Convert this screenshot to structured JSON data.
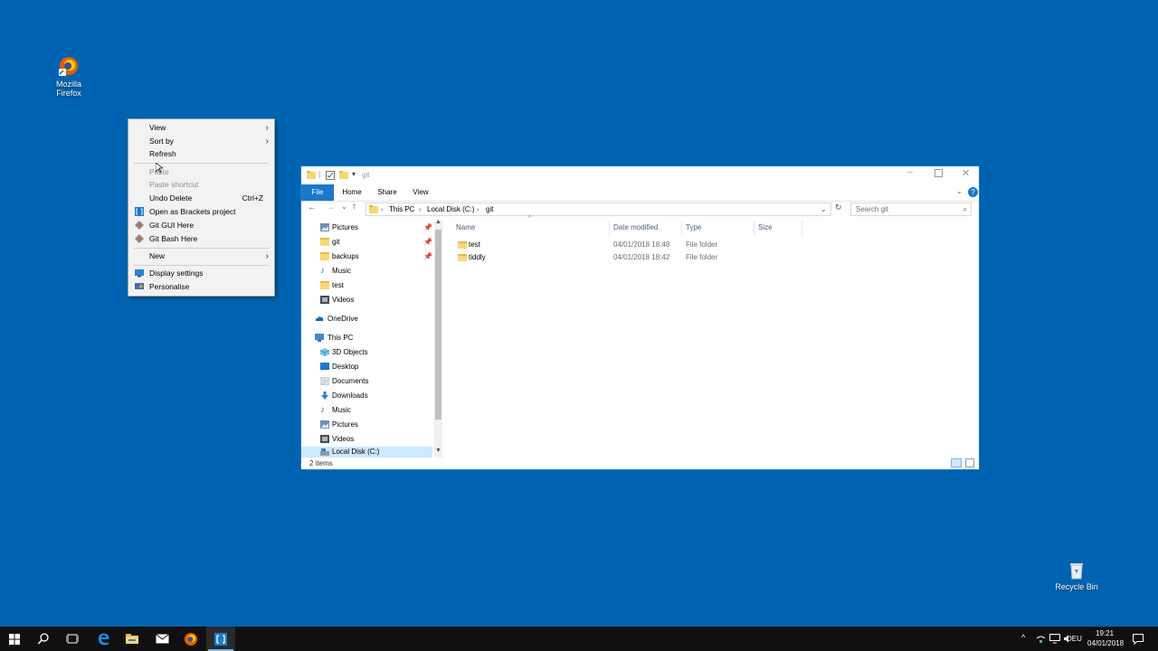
{
  "desktop": {
    "icons": [
      {
        "name": "Mozilla Firefox",
        "line1": "Mozilla",
        "line2": "Firefox",
        "icon": "firefox-icon"
      },
      {
        "name": "Recycle Bin",
        "label": "Recycle Bin",
        "icon": "recycle-bin-icon"
      }
    ]
  },
  "context_menu": {
    "items": [
      {
        "label": "View",
        "submenu": true
      },
      {
        "label": "Sort by",
        "submenu": true
      },
      {
        "label": "Refresh"
      },
      {
        "label": "Paste",
        "disabled": true
      },
      {
        "label": "Paste shortcut",
        "disabled": true
      },
      {
        "label": "Undo Delete",
        "shortcut": "Ctrl+Z"
      },
      {
        "label": "Open as Brackets project",
        "icon": "brackets-icon"
      },
      {
        "label": "Git GUI Here",
        "icon": "git-icon"
      },
      {
        "label": "Git Bash Here",
        "icon": "git-icon"
      },
      {
        "label": "New",
        "submenu": true
      },
      {
        "label": "Display settings",
        "icon": "display-icon"
      },
      {
        "label": "Personalise",
        "icon": "personalise-icon"
      }
    ]
  },
  "explorer": {
    "title": "git",
    "ribbon_tabs": [
      "File",
      "Home",
      "Share",
      "View"
    ],
    "breadcrumb": [
      "This PC",
      "Local Disk (C:)",
      "git"
    ],
    "search_placeholder": "Search git",
    "nav_items": [
      {
        "label": "Pictures",
        "icon": "pictures-icon",
        "pinned": true
      },
      {
        "label": "git",
        "icon": "folder-icon",
        "pinned": true
      },
      {
        "label": "backups",
        "icon": "folder-icon",
        "pinned": true
      },
      {
        "label": "Music",
        "icon": "music-icon"
      },
      {
        "label": "test",
        "icon": "folder-icon"
      },
      {
        "label": "Videos",
        "icon": "videos-icon"
      },
      {
        "label": "OneDrive",
        "icon": "onedrive-icon",
        "top": true
      },
      {
        "label": "This PC",
        "icon": "pc-icon",
        "top": true
      },
      {
        "label": "3D Objects",
        "icon": "3d-objects-icon"
      },
      {
        "label": "Desktop",
        "icon": "desktop-icon"
      },
      {
        "label": "Documents",
        "icon": "documents-icon"
      },
      {
        "label": "Downloads",
        "icon": "downloads-icon"
      },
      {
        "label": "Music",
        "icon": "music-icon"
      },
      {
        "label": "Pictures",
        "icon": "pictures-icon"
      },
      {
        "label": "Videos",
        "icon": "videos-icon"
      },
      {
        "label": "Local Disk (C:)",
        "icon": "drive-icon",
        "selected": true
      }
    ],
    "columns": [
      "Name",
      "Date modified",
      "Type",
      "Size"
    ],
    "files": [
      {
        "name": "test",
        "modified": "04/01/2018 18:48",
        "type": "File folder",
        "size": ""
      },
      {
        "name": "tiddly",
        "modified": "04/01/2018 18:42",
        "type": "File folder",
        "size": ""
      }
    ],
    "status": "2 items"
  },
  "taskbar": {
    "apps": [
      "start-icon",
      "search-icon",
      "task-view-icon",
      "edge-icon",
      "file-explorer-icon",
      "mail-icon",
      "firefox-icon",
      "brackets-icon"
    ],
    "language": "DEU",
    "time": "19:21",
    "date": "04/01/2018"
  },
  "colors": {
    "desktop": "#0063b1",
    "accent": "#1979ca",
    "taskbar": "#101010"
  }
}
